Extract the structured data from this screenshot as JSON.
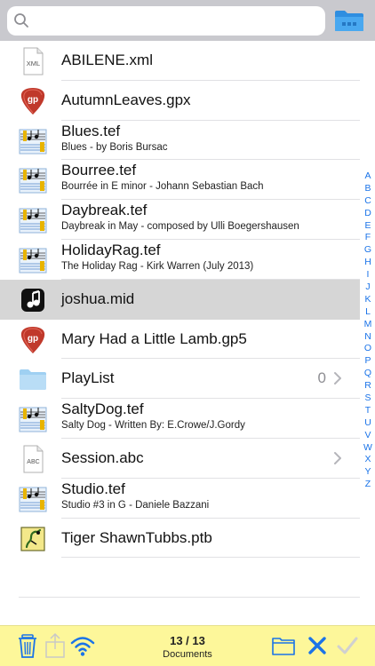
{
  "search": {
    "placeholder": "",
    "value": ""
  },
  "files": [
    {
      "name": "ABILENE.xml",
      "subtitle": "",
      "icon": "xml-file-icon",
      "icon_label": "XML"
    },
    {
      "name": "AutumnLeaves.gpx",
      "subtitle": "",
      "icon": "guitar-pick-icon",
      "icon_label": "gp"
    },
    {
      "name": "Blues.tef",
      "subtitle": "Blues - by Boris Bursac",
      "icon": "tablature-icon"
    },
    {
      "name": "Bourree.tef",
      "subtitle": "Bourrée in E minor - Johann Sebastian Bach",
      "icon": "tablature-icon"
    },
    {
      "name": "Daybreak.tef",
      "subtitle": "Daybreak in May - composed by Ulli Boegershausen",
      "icon": "tablature-icon"
    },
    {
      "name": "HolidayRag.tef",
      "subtitle": "The Holiday Rag - Kirk Warren (July 2013)",
      "icon": "tablature-icon"
    },
    {
      "name": "joshua.mid",
      "subtitle": "",
      "icon": "midi-file-icon",
      "selected": true
    },
    {
      "name": "Mary Had a Little Lamb.gp5",
      "subtitle": "",
      "icon": "guitar-pick-icon",
      "icon_label": "gp"
    },
    {
      "name": "PlayList",
      "subtitle": "",
      "icon": "folder-icon",
      "count": "0"
    },
    {
      "name": "SaltyDog.tef",
      "subtitle": "Salty Dog -    Written By: E.Crowe/J.Gordy",
      "icon": "tablature-icon"
    },
    {
      "name": "Session.abc",
      "subtitle": "",
      "icon": "abc-file-icon",
      "icon_label": "ABC"
    },
    {
      "name": "Studio.tef",
      "subtitle": "Studio #3 in G - Daniele Bazzani",
      "icon": "tablature-icon"
    },
    {
      "name": "Tiger ShawnTubbs.ptb",
      "subtitle": "",
      "icon": "ptb-file-icon"
    }
  ],
  "index_letters": [
    "A",
    "B",
    "C",
    "D",
    "E",
    "F",
    "G",
    "H",
    "I",
    "J",
    "K",
    "L",
    "M",
    "N",
    "O",
    "P",
    "Q",
    "R",
    "S",
    "T",
    "U",
    "V",
    "W",
    "X",
    "Y",
    "Z"
  ],
  "toolbar": {
    "count": "13 / 13",
    "label": "Documents"
  },
  "colors": {
    "accent": "#1a73e8",
    "toolbar_bg": "#fdf79a",
    "selected_row": "#d6d6d6",
    "folder_blue": "#3aa0e8",
    "guitar_red": "#c0392b"
  }
}
